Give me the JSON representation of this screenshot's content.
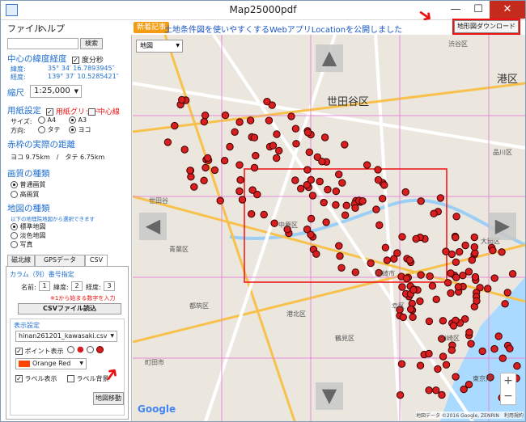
{
  "window": {
    "title": "Map25000pdf",
    "min_label": "—",
    "max_label": "☐",
    "close_label": "✕"
  },
  "menu": {
    "file": "ファイル",
    "help": "ヘルプ"
  },
  "banner": {
    "badge": "新着記事",
    "text": "土地条件図を使いやすくするWebアプリLocationを公開しました"
  },
  "download_button": {
    "label": "地形図ダウンロード開始"
  },
  "search": {
    "value": "",
    "button": "検索"
  },
  "center": {
    "heading": "中心の緯度経度",
    "degree_label": "度分秒",
    "lat_label": "緯度:",
    "lat_value": "35° 34′ 16.7893945″",
    "lng_label": "経度:",
    "lng_value": "139° 37′ 10.5285421″"
  },
  "scale": {
    "heading": "縮尺",
    "value": "1:25,000"
  },
  "paper": {
    "heading": "用紙設定",
    "grid_label": "用紙グリッド",
    "center_line_label": "中心線",
    "size_label": "サイズ:",
    "size_a4": "A4",
    "size_a3": "A3",
    "orient_label": "方向:",
    "orient_portrait": "タテ",
    "orient_landscape": "ヨコ"
  },
  "distance": {
    "heading": "赤枠の実際の距離",
    "value": "ヨコ 9.75km　/　タテ 6.75km"
  },
  "quality": {
    "heading": "画質の種類",
    "normal": "普通画質",
    "high": "高画質"
  },
  "maptype": {
    "heading": "地図の種類",
    "note": "以下の地理院地図から選択できます",
    "standard": "標準地図",
    "pale": "淡色地図",
    "photo": "写真"
  },
  "tabs": {
    "t1": "磁北線",
    "t2": "GPSデータ (GPX)",
    "t3": "CSV"
  },
  "csv": {
    "col_heading": "カラム（列）番号指定",
    "name_label": "名前:",
    "name_value": "1",
    "lat_label": "緯度:",
    "lat_value": "2",
    "lng_label": "経度:",
    "lng_value": "3",
    "note": "※1から始まる数字を入力",
    "load_button": "CSVファイル読込",
    "display_heading": "表示設定",
    "file_select": "hinan261201_kawasaki.csv",
    "point_label": "ポイント表示",
    "color_select": "Orange Red",
    "label_show": "ラベル表示",
    "label_bg": "ラベル背景",
    "move_button": "地図移動"
  },
  "map": {
    "type_select": "地図",
    "labels": [
      "世田谷区",
      "渋谷区",
      "港区",
      "品川区",
      "大田区",
      "川崎市",
      "中原区",
      "幸区",
      "青葉区",
      "都筑区",
      "港北区",
      "鶴見区",
      "川崎区",
      "東京湾",
      "世田谷",
      "町田市"
    ],
    "google": "Google",
    "footer": "地図データ ©2016 Google, ZENRIN　利用規約",
    "zoom_in": "+",
    "zoom_out": "−"
  },
  "colors": {
    "accent": "#1f6fd1",
    "marker": "#d81e1e",
    "highlight": "#e11111"
  }
}
